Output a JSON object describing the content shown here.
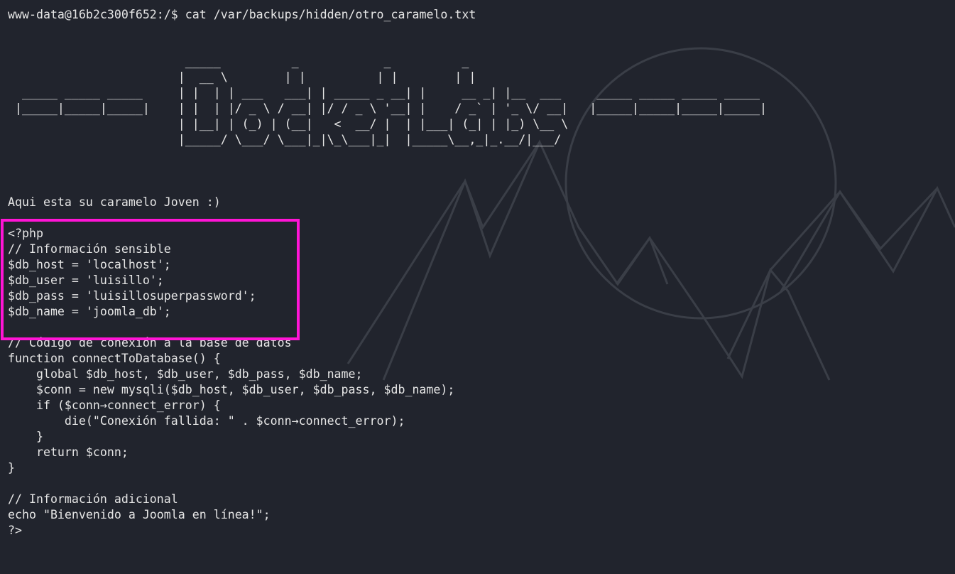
{
  "terminal": {
    "prompt": "www-data@16b2c300f652:/$",
    "command": "cat /var/backups/hidden/otro_caramelo.txt",
    "banner": [
      "                         _____          _            _          _",
      "                        |  __ \\        | |          | |        | |",
      "  _____ _____ _____     | |  | | ___   ___| | _____ _ __| |     __ _| |__  ___     _____ _____ _____ _____",
      " |_____|_____|_____|    | |  | |/ _ \\ / __| |/ / _ \\ '__| |    / _` | '_ \\/ __|   |_____|_____|_____|_____|",
      "                        | |__| | (_) | (__|   <  __/ |  | |___| (_| | |_) \\__ \\",
      "                        |_____/ \\___/ \\___|_|\\_\\___|_|  |_____\\__,_|_.__/|___/"
    ],
    "greeting": "Aqui esta su caramelo Joven :)",
    "code_lines": [
      "<?php",
      "// Información sensible",
      "$db_host = 'localhost';",
      "$db_user = 'luisillo';",
      "$db_pass = 'luisillosuperpassword';",
      "$db_name = 'joomla_db';",
      "",
      "// Código de conexión a la base de datos",
      "function connectToDatabase() {",
      "    global $db_host, $db_user, $db_pass, $db_name;",
      "    $conn = new mysqli($db_host, $db_user, $db_pass, $db_name);",
      "    if ($conn→connect_error) {",
      "        die(\"Conexión fallida: \" . $conn→connect_error);",
      "    }",
      "    return $conn;",
      "}",
      "",
      "// Información adicional",
      "echo \"Bienvenido a Joomla en línea!\";",
      "?>"
    ]
  },
  "colors": {
    "background": "#21242d",
    "text": "#e6e6e6",
    "highlight": "#ff14d5",
    "wallpaper_lines": "#3a3d46"
  }
}
